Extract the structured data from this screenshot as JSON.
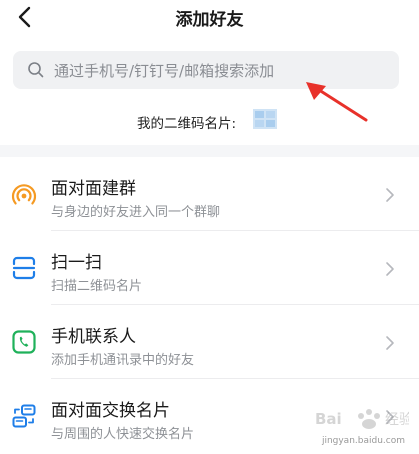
{
  "header": {
    "title": "添加好友"
  },
  "search": {
    "placeholder": "通过手机号/钉钉号/邮箱搜索添加"
  },
  "qr": {
    "label": "我的二维码名片:"
  },
  "items": [
    {
      "title": "面对面建群",
      "subtitle": "与身边的好友进入同一个群聊",
      "icon": "radar-icon",
      "color": "#f59a23"
    },
    {
      "title": "扫一扫",
      "subtitle": "扫描二维码名片",
      "icon": "scan-icon",
      "color": "#1e7ee8"
    },
    {
      "title": "手机联系人",
      "subtitle": "添加手机通讯录中的好友",
      "icon": "phone-icon",
      "color": "#1fb15a"
    },
    {
      "title": "面对面交换名片",
      "subtitle": "与周围的人快速交换名片",
      "icon": "exchange-card-icon",
      "color": "#1e7ee8"
    }
  ],
  "watermark": {
    "text": "Bai 经验",
    "url": "jingyan.baidu.com"
  },
  "colors": {
    "arrow": "#e8312a",
    "search_bg": "#f0f1f3"
  }
}
